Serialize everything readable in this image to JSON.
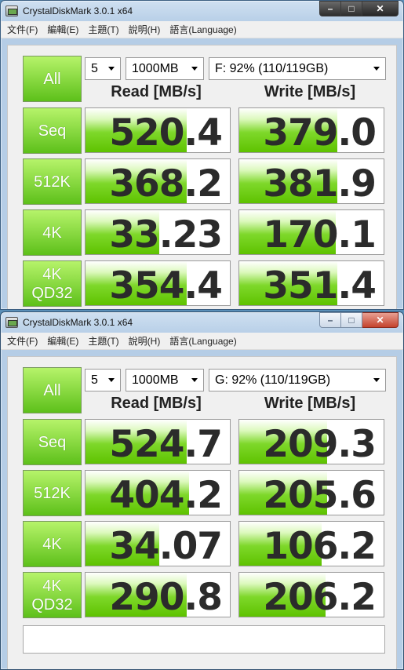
{
  "windows": [
    {
      "title": "CrystalDiskMark 3.0.1 x64",
      "menu": [
        "文件(F)",
        "編輯(E)",
        "主題(T)",
        "說明(H)",
        "語言(Language)"
      ],
      "all_label": "All",
      "count": "5",
      "size": "1000MB",
      "drive": "F: 92% (110/119GB)",
      "read_header": "Read [MB/s]",
      "write_header": "Write [MB/s]",
      "rows": [
        {
          "label": "Seq",
          "read": "520.4",
          "write": "379.0",
          "read_pct": 0.7,
          "write_pct": 0.68
        },
        {
          "label": "512K",
          "read": "368.2",
          "write": "381.9",
          "read_pct": 0.7,
          "write_pct": 0.68
        },
        {
          "label": "4K",
          "read": "33.23",
          "write": "170.1",
          "read_pct": 0.51,
          "write_pct": 0.67
        },
        {
          "label": "4K\nQD32",
          "read": "354.4",
          "write": "351.4",
          "read_pct": 0.7,
          "write_pct": 0.68
        }
      ]
    },
    {
      "title": "CrystalDiskMark 3.0.1 x64",
      "menu": [
        "文件(F)",
        "編輯(E)",
        "主題(T)",
        "說明(H)",
        "語言(Language)"
      ],
      "all_label": "All",
      "count": "5",
      "size": "1000MB",
      "drive": "G: 92% (110/119GB)",
      "read_header": "Read [MB/s]",
      "write_header": "Write [MB/s]",
      "rows": [
        {
          "label": "Seq",
          "read": "524.7",
          "write": "209.3",
          "read_pct": 0.7,
          "write_pct": 0.61
        },
        {
          "label": "512K",
          "read": "404.2",
          "write": "205.6",
          "read_pct": 0.72,
          "write_pct": 0.61
        },
        {
          "label": "4K",
          "read": "34.07",
          "write": "106.2",
          "read_pct": 0.51,
          "write_pct": 0.57
        },
        {
          "label": "4K\nQD32",
          "read": "290.8",
          "write": "206.2",
          "read_pct": 0.7,
          "write_pct": 0.6
        }
      ],
      "comment": ""
    }
  ]
}
